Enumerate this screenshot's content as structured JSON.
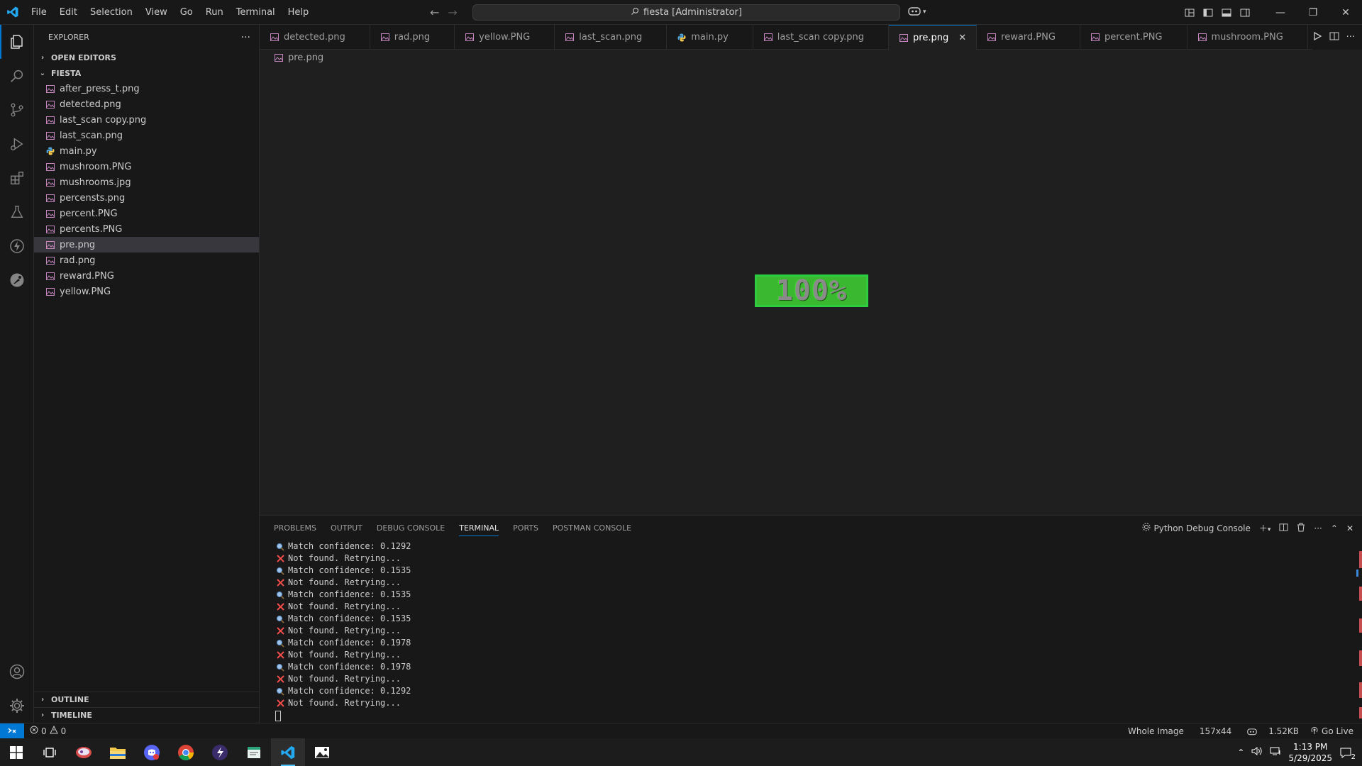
{
  "titlebar": {
    "menu": [
      "File",
      "Edit",
      "Selection",
      "View",
      "Go",
      "Run",
      "Terminal",
      "Help"
    ],
    "search_text": "fiesta [Administrator]"
  },
  "sidebar": {
    "title": "EXPLORER",
    "open_editors": "OPEN EDITORS",
    "folder": "FIESTA",
    "files": [
      {
        "name": "after_press_t.png",
        "type": "image"
      },
      {
        "name": "detected.png",
        "type": "image"
      },
      {
        "name": "last_scan copy.png",
        "type": "image"
      },
      {
        "name": "last_scan.png",
        "type": "image"
      },
      {
        "name": "main.py",
        "type": "python"
      },
      {
        "name": "mushroom.PNG",
        "type": "image"
      },
      {
        "name": "mushrooms.jpg",
        "type": "image"
      },
      {
        "name": "percensts.png",
        "type": "image"
      },
      {
        "name": "percent.PNG",
        "type": "image"
      },
      {
        "name": "percents.PNG",
        "type": "image"
      },
      {
        "name": "pre.png",
        "type": "image",
        "selected": true
      },
      {
        "name": "rad.png",
        "type": "image"
      },
      {
        "name": "reward.PNG",
        "type": "image"
      },
      {
        "name": "yellow.PNG",
        "type": "image"
      }
    ],
    "outline": "OUTLINE",
    "timeline": "TIMELINE"
  },
  "tabs": [
    {
      "label": "detected.png",
      "type": "image"
    },
    {
      "label": "rad.png",
      "type": "image"
    },
    {
      "label": "yellow.PNG",
      "type": "image"
    },
    {
      "label": "last_scan.png",
      "type": "image"
    },
    {
      "label": "main.py",
      "type": "python"
    },
    {
      "label": "last_scan copy.png",
      "type": "image"
    },
    {
      "label": "pre.png",
      "type": "image",
      "active": true
    },
    {
      "label": "reward.PNG",
      "type": "image"
    },
    {
      "label": "percent.PNG",
      "type": "image"
    },
    {
      "label": "mushroom.PNG",
      "type": "image"
    }
  ],
  "breadcrumb": "pre.png",
  "preview": {
    "text": "100%",
    "accent": "#2ecc40"
  },
  "panel": {
    "tabs": [
      "PROBLEMS",
      "OUTPUT",
      "DEBUG CONSOLE",
      "TERMINAL",
      "PORTS",
      "POSTMAN CONSOLE"
    ],
    "active_tab": "TERMINAL",
    "terminal_name": "Python Debug Console",
    "lines": [
      {
        "icon": "search",
        "text": "Match confidence: 0.1292"
      },
      {
        "icon": "x",
        "text": "Not found. Retrying..."
      },
      {
        "icon": "search",
        "text": "Match confidence: 0.1535"
      },
      {
        "icon": "x",
        "text": "Not found. Retrying..."
      },
      {
        "icon": "search",
        "text": "Match confidence: 0.1535"
      },
      {
        "icon": "x",
        "text": "Not found. Retrying..."
      },
      {
        "icon": "search",
        "text": "Match confidence: 0.1535"
      },
      {
        "icon": "x",
        "text": "Not found. Retrying..."
      },
      {
        "icon": "search",
        "text": "Match confidence: 0.1978"
      },
      {
        "icon": "x",
        "text": "Not found. Retrying..."
      },
      {
        "icon": "search",
        "text": "Match confidence: 0.1978"
      },
      {
        "icon": "x",
        "text": "Not found. Retrying..."
      },
      {
        "icon": "search",
        "text": "Match confidence: 0.1292"
      },
      {
        "icon": "x",
        "text": "Not found. Retrying..."
      }
    ]
  },
  "status": {
    "errors": "0",
    "warnings": "0",
    "whole_image": "Whole Image",
    "dimensions": "157x44",
    "size": "1.52KB",
    "go_live": "Go Live"
  },
  "taskbar": {
    "time": "1:13 PM",
    "date": "5/29/2025",
    "notifications": "2"
  },
  "colors": {
    "accent": "#0078d4",
    "image_icon": "#c586c0",
    "python_icon": "#4fa3d8",
    "error_x": "#f14c4c"
  }
}
